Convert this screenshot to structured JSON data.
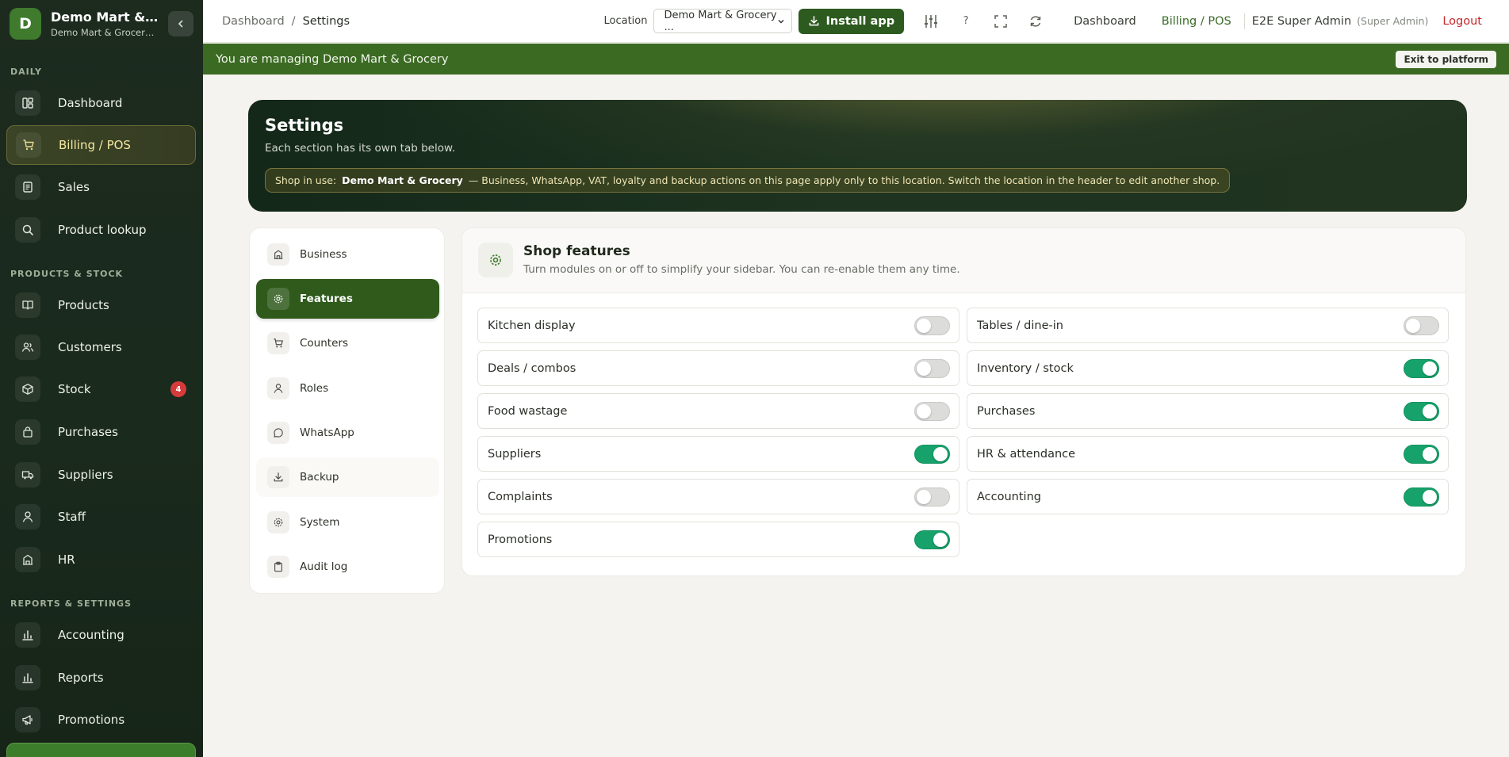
{
  "sidebar": {
    "brand_initial": "D",
    "brand_name": "Demo Mart & Grocery",
    "brand_sub": "Demo Mart & Grocery (Demo)",
    "sections": [
      "DAILY",
      "PRODUCTS & STOCK",
      "REPORTS & SETTINGS"
    ],
    "items": [
      {
        "label": "Dashboard",
        "icon": "dashboard-icon"
      },
      {
        "label": "Billing / POS",
        "icon": "cart-icon",
        "active": true
      },
      {
        "label": "Sales",
        "icon": "receipt-icon"
      },
      {
        "label": "Product lookup",
        "icon": "search-icon"
      },
      {
        "label": "Products",
        "icon": "book-icon"
      },
      {
        "label": "Customers",
        "icon": "customers-icon"
      },
      {
        "label": "Stock",
        "icon": "box-icon",
        "badge": "4"
      },
      {
        "label": "Purchases",
        "icon": "bag-icon"
      },
      {
        "label": "Suppliers",
        "icon": "truck-icon"
      },
      {
        "label": "Staff",
        "icon": "user-icon"
      },
      {
        "label": "HR",
        "icon": "building-icon"
      },
      {
        "label": "Accounting",
        "icon": "chart-icon"
      },
      {
        "label": "Reports",
        "icon": "chart-icon"
      },
      {
        "label": "Promotions",
        "icon": "megaphone-icon"
      }
    ]
  },
  "topbar": {
    "breadcrumb": [
      "Dashboard",
      "Settings"
    ],
    "location_label": "Location",
    "location_value": "Demo Mart & Grocery ...",
    "install_label": "Install app",
    "help_label": "?",
    "links": [
      "Dashboard",
      "Billing / POS"
    ],
    "user": "E2E Super Admin",
    "role": "(Super Admin)",
    "logout": "Logout"
  },
  "banner": {
    "text": "You are managing Demo Mart & Grocery",
    "exit_label": "Exit to platform"
  },
  "hero": {
    "title": "Settings",
    "subtitle": "Each section has its own tab below.",
    "shop_prefix": "Shop in use:",
    "shop_name": "Demo Mart & Grocery",
    "shop_note": "— Business, WhatsApp, VAT, loyalty and backup actions on this page apply only to this location. Switch the location in the header to edit another shop."
  },
  "settings_nav": [
    {
      "label": "Business",
      "icon": "building-icon"
    },
    {
      "label": "Features",
      "icon": "gear-icon",
      "active": true
    },
    {
      "label": "Counters",
      "icon": "cart-icon"
    },
    {
      "label": "Roles",
      "icon": "user-icon"
    },
    {
      "label": "WhatsApp",
      "icon": "chat-icon"
    },
    {
      "label": "Backup",
      "icon": "download-icon"
    },
    {
      "label": "System",
      "icon": "gear-icon"
    },
    {
      "label": "Audit log",
      "icon": "clipboard-icon"
    }
  ],
  "features": {
    "title": "Shop features",
    "description": "Turn modules on or off to simplify your sidebar. You can re-enable them any time.",
    "toggles": [
      {
        "label": "Kitchen display",
        "on": false
      },
      {
        "label": "Tables / dine-in",
        "on": false
      },
      {
        "label": "Deals / combos",
        "on": false
      },
      {
        "label": "Inventory / stock",
        "on": true
      },
      {
        "label": "Food wastage",
        "on": false
      },
      {
        "label": "Purchases",
        "on": true
      },
      {
        "label": "Suppliers",
        "on": true
      },
      {
        "label": "HR & attendance",
        "on": true
      },
      {
        "label": "Complaints",
        "on": false
      },
      {
        "label": "Accounting",
        "on": true
      },
      {
        "label": "Promotions",
        "on": true
      }
    ]
  },
  "colors": {
    "sidebar_bg": "#1d2b1f",
    "accent_green": "#2d5a1e",
    "toggle_on": "#17a26b",
    "logout_red": "#c4262b",
    "banner_green": "#3b6a23"
  }
}
